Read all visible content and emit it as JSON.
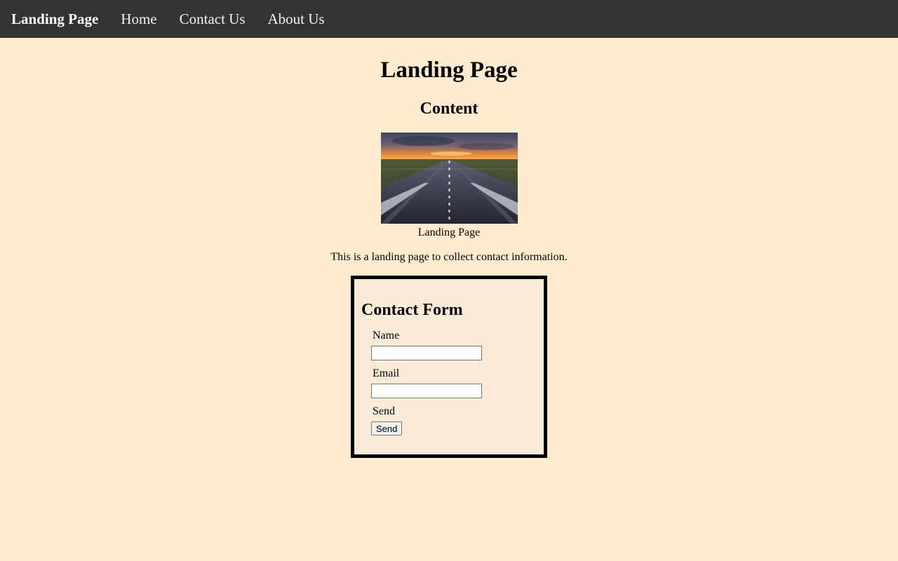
{
  "navbar": {
    "brand": "Landing Page",
    "links": [
      "Home",
      "Contact Us",
      "About Us"
    ]
  },
  "main": {
    "title": "Landing Page",
    "section_title": "Content",
    "image_caption": "Landing Page",
    "description": "This is a landing page to collect contact information."
  },
  "contact_form": {
    "title": "Contact Form",
    "name_label": "Name",
    "name_value": "",
    "email_label": "Email",
    "email_value": "",
    "send_label": "Send",
    "send_button": "Send"
  },
  "colors": {
    "page_background": "#ffebcd",
    "navbar_background": "#333333",
    "form_background": "#faebd7"
  }
}
